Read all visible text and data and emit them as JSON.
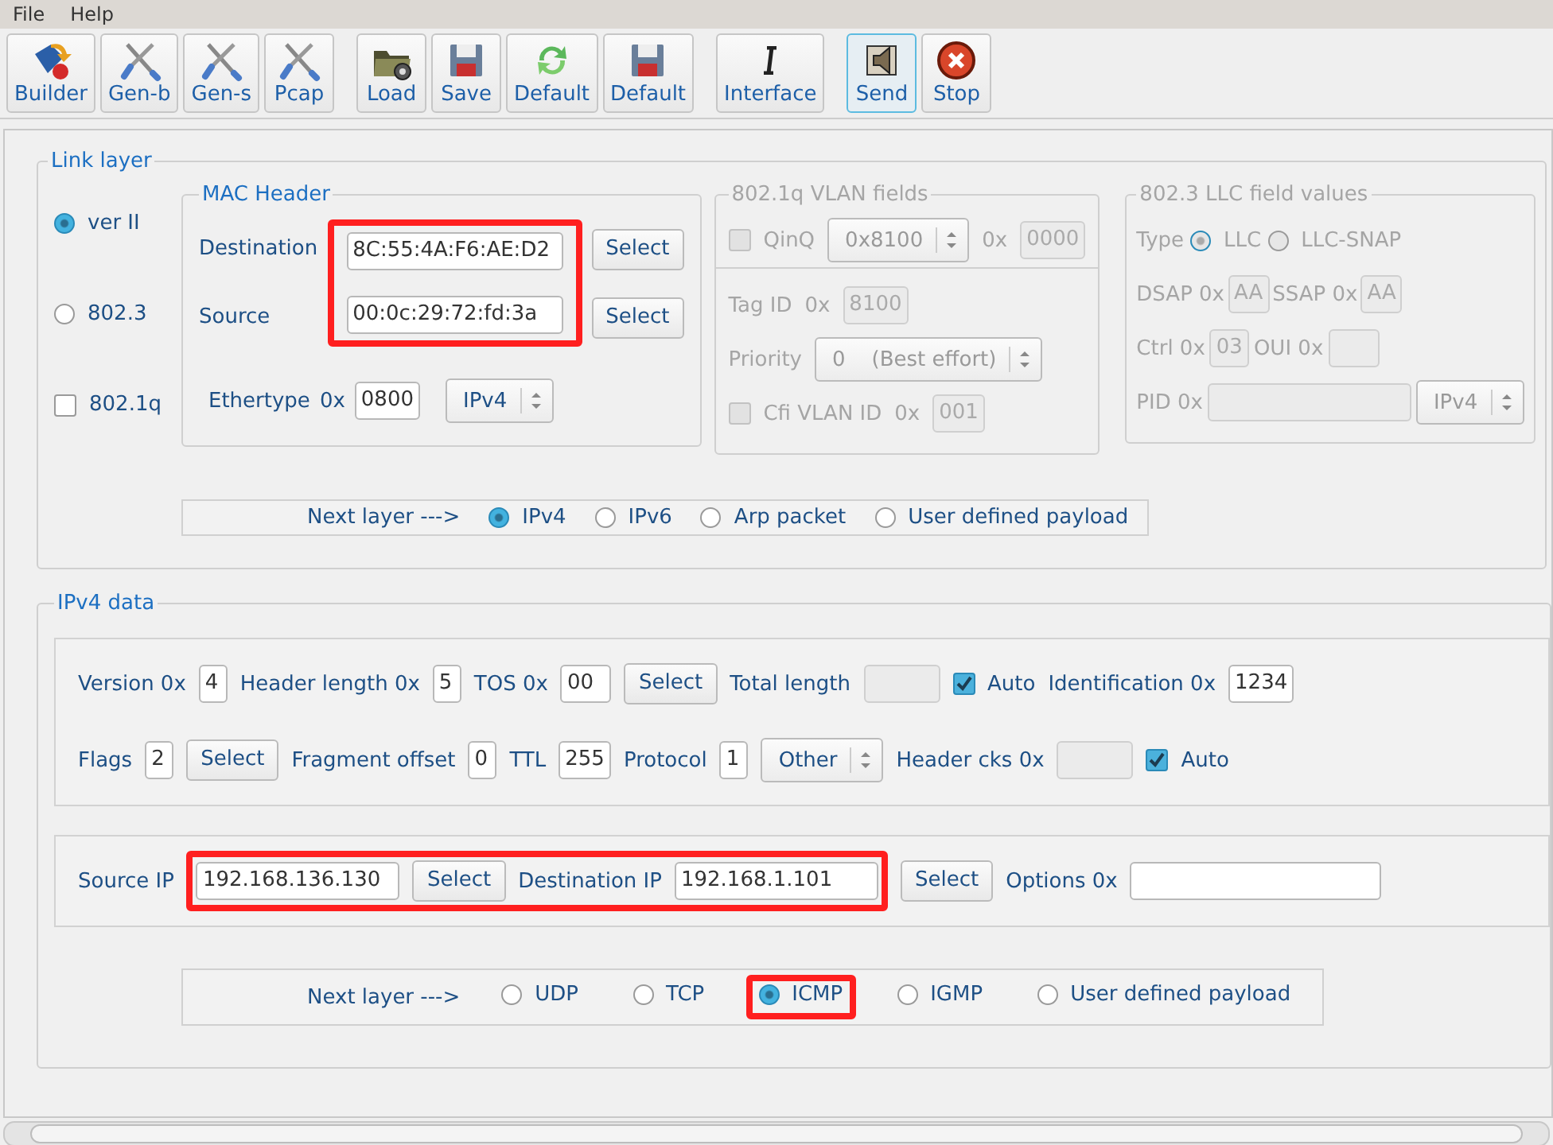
{
  "menu": [
    {
      "label": "File"
    },
    {
      "label": "Help"
    }
  ],
  "toolbar": [
    {
      "buttons": [
        {
          "label": "Builder",
          "kind": "builder",
          "selected": false
        },
        {
          "label": "Gen-b",
          "kind": "tools",
          "selected": false
        },
        {
          "label": "Gen-s",
          "kind": "tools",
          "selected": false
        },
        {
          "label": "Pcap",
          "kind": "tools",
          "selected": false
        }
      ]
    },
    {
      "buttons": [
        {
          "label": "Load",
          "kind": "folder",
          "selected": false
        },
        {
          "label": "Save",
          "kind": "floppy",
          "selected": false
        },
        {
          "label": "Default",
          "kind": "recycle",
          "selected": false
        },
        {
          "label": "Default",
          "kind": "floppy",
          "selected": false
        }
      ]
    },
    {
      "buttons": [
        {
          "label": "Interface",
          "kind": "ibeam",
          "selected": false
        }
      ]
    },
    {
      "buttons": [
        {
          "label": "Send",
          "kind": "speaker",
          "selected": true
        },
        {
          "label": "Stop",
          "kind": "stop",
          "selected": false
        }
      ]
    }
  ],
  "link_layer": {
    "title": "Link layer",
    "frame_types": [
      {
        "kind": "radio",
        "label": "ver II",
        "checked": true
      },
      {
        "kind": "radio",
        "label": "802.3",
        "checked": false
      },
      {
        "kind": "checkbox",
        "label": "802.1q",
        "checked": false
      }
    ],
    "mac_header": {
      "title": "MAC Header",
      "highlighted": true,
      "destination": {
        "label": "Destination",
        "value": "8C:55:4A:F6:AE:D2",
        "button": "Select"
      },
      "source": {
        "label": "Source",
        "value": "00:0c:29:72:fd:3a",
        "button": "Select"
      },
      "ethertype": {
        "label": "Ethertype",
        "prefix": "0x",
        "value": "0800",
        "combo": "IPv4"
      }
    },
    "vlan": {
      "title": "802.1q VLAN fields",
      "disabled": true,
      "qinq": {
        "label": "QinQ",
        "checked": false,
        "combo": "0x8100",
        "prefix": "0x",
        "value": "0000"
      },
      "tag_id": {
        "label": "Tag ID",
        "prefix": "0x",
        "value": "8100"
      },
      "priority": {
        "label": "Priority",
        "combo": "0    (Best effort)"
      },
      "cfi": {
        "label": "Cfi VLAN ID",
        "checked": false,
        "prefix": "0x",
        "value": "001"
      }
    },
    "llc": {
      "title": "802.3 LLC field values",
      "disabled": true,
      "type_label": "Type",
      "types": [
        {
          "label": "LLC",
          "selected": true
        },
        {
          "label": "LLC-SNAP",
          "selected": false
        }
      ],
      "dsap": {
        "label": "DSAP 0x",
        "value": "AA"
      },
      "ssap": {
        "label": "SSAP 0x",
        "value": "AA"
      },
      "ctrl": {
        "label": "Ctrl 0x",
        "value": "03"
      },
      "oui": {
        "label": "OUI 0x"
      },
      "pid": {
        "label": "PID 0x",
        "combo": "IPv4"
      }
    },
    "next_layer": {
      "label": "Next layer  --->",
      "options": [
        {
          "label": "IPv4",
          "selected": true
        },
        {
          "label": "IPv6",
          "selected": false
        },
        {
          "label": "Arp packet",
          "selected": false
        },
        {
          "label": "User defined payload",
          "selected": false
        }
      ]
    }
  },
  "ipv4": {
    "title": "IPv4 data",
    "rows": [
      {
        "items": [
          {
            "kind": "field",
            "label": "Version 0x",
            "value": "4"
          },
          {
            "kind": "field",
            "label": "Header length 0x",
            "value": "5"
          },
          {
            "kind": "field",
            "label": "TOS 0x",
            "value": "00"
          },
          {
            "kind": "button",
            "label": "Select"
          },
          {
            "kind": "field",
            "label": "Total length",
            "disabled": true
          },
          {
            "kind": "checkbox",
            "label": "Auto",
            "checked": true
          },
          {
            "kind": "field",
            "label": "Identification 0x",
            "value": "1234"
          }
        ]
      },
      {
        "items": [
          {
            "kind": "field",
            "label": "Flags",
            "value": "2"
          },
          {
            "kind": "button",
            "label": "Select"
          },
          {
            "kind": "field",
            "label": "Fragment offset",
            "value": "0"
          },
          {
            "kind": "field",
            "label": "TTL",
            "value": "255"
          },
          {
            "kind": "field",
            "label": "Protocol",
            "value": "1"
          },
          {
            "kind": "combo",
            "label": "Other"
          },
          {
            "kind": "field",
            "label": "Header cks 0x",
            "disabled": true
          },
          {
            "kind": "checkbox",
            "label": "Auto",
            "checked": true
          }
        ]
      }
    ],
    "address_row": [
      {
        "kind": "label",
        "label": "Source IP"
      },
      {
        "kind": "highlight",
        "highlighted": true,
        "items": [
          {
            "kind": "field",
            "value": "192.168.136.130"
          },
          {
            "kind": "button",
            "label": "Select"
          },
          {
            "kind": "field",
            "label": "Destination IP",
            "value": "192.168.1.101"
          }
        ]
      },
      {
        "kind": "button",
        "label": "Select"
      },
      {
        "kind": "field",
        "label": "Options 0x"
      }
    ],
    "next_layer": {
      "label": "Next layer  --->",
      "options": [
        {
          "label": "UDP",
          "selected": false,
          "highlighted": false
        },
        {
          "label": "TCP",
          "selected": false,
          "highlighted": false
        },
        {
          "label": "ICMP",
          "selected": true,
          "highlighted": true
        },
        {
          "label": "IGMP",
          "selected": false,
          "highlighted": false
        },
        {
          "label": "User defined payload",
          "selected": false,
          "highlighted": false
        }
      ]
    }
  }
}
